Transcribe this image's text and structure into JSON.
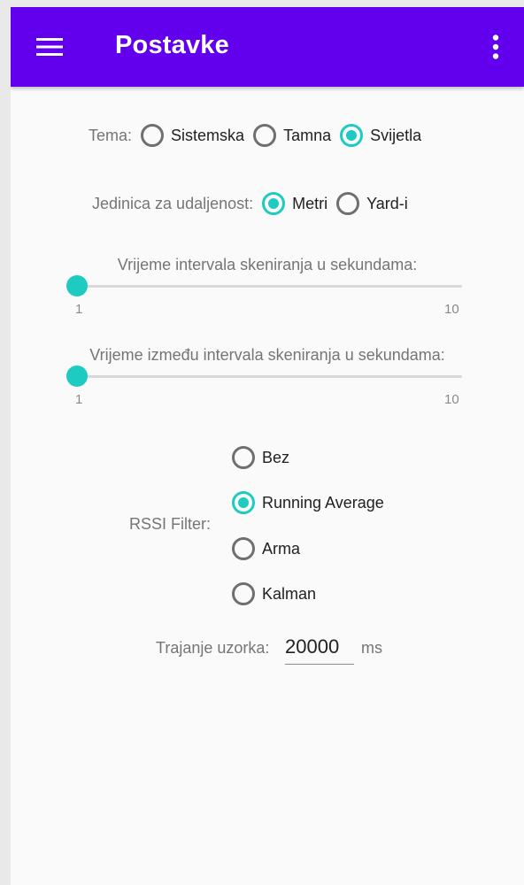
{
  "appbar": {
    "title": "Postavke",
    "menu_icon": "hamburger-menu-icon",
    "overflow_icon": "more-vert-icon",
    "color": "#6200ee"
  },
  "accent_color": "#1ecbc0",
  "theme": {
    "label": "Tema:",
    "options": [
      "Sistemska",
      "Tamna",
      "Svijetla"
    ],
    "selected": "Svijetla"
  },
  "distance_unit": {
    "label": "Jedinica za udaljenost:",
    "options": [
      "Metri",
      "Yard-i"
    ],
    "selected": "Metri"
  },
  "scan_interval": {
    "label": "Vrijeme intervala skeniranja u sekundama:",
    "min_label": "1",
    "max_label": "10",
    "value": 1
  },
  "between_interval": {
    "label": "Vrijeme između intervala skeniranja u sekundama:",
    "min_label": "1",
    "max_label": "10",
    "value": 1
  },
  "rssi_filter": {
    "label": "RSSI Filter:",
    "options": [
      "Bez",
      "Running Average",
      "Arma",
      "Kalman"
    ],
    "selected": "Running Average"
  },
  "sample_duration": {
    "label": "Trajanje uzorka:",
    "value": "20000",
    "unit": "ms"
  }
}
